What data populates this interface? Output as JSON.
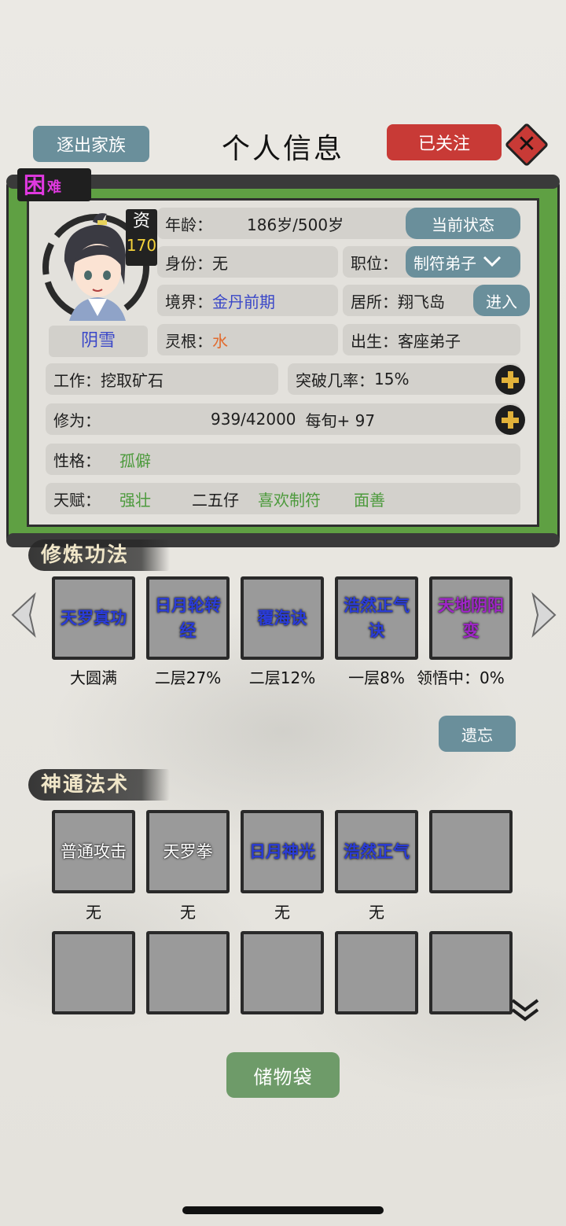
{
  "header": {
    "title": "个人信息",
    "expel_button": "逐出家族",
    "follow_button": "已关注"
  },
  "profile": {
    "status_tag_big": "困",
    "status_tag_small": "难",
    "aptitude_label": "资",
    "aptitude_value": "170",
    "name": "阴雪",
    "age_label": "年龄：",
    "age_value": "186岁/500岁",
    "current_state_button": "当前状态",
    "identity_label": "身份：",
    "identity_value": "无",
    "position_label": "职位：",
    "position_value": "制符弟子",
    "realm_label": "境界：",
    "realm_value": "金丹前期",
    "residence_label": "居所：",
    "residence_value": "翔飞岛",
    "enter_button": "进入",
    "root_label": "灵根：",
    "root_value": "水",
    "birth_label": "出生：",
    "birth_value": "客座弟子",
    "work_label": "工作：",
    "work_value": "挖取矿石",
    "breakthrough_label": "突破几率：",
    "breakthrough_value": "15%",
    "cultivation_label": "修为：",
    "cultivation_value": "939/42000",
    "cultivation_rate": "每旬+ 97",
    "personality_label": "性格：",
    "personality_value": "孤僻",
    "talent_label": "天赋：",
    "talents": [
      "强壮",
      "二五仔",
      "喜欢制符",
      "面善"
    ]
  },
  "techniques": {
    "heading": "修炼功法",
    "items": [
      {
        "name": "天罗真功",
        "progress": "大圆满"
      },
      {
        "name": "日月轮转经",
        "progress": "二层27%"
      },
      {
        "name": "覆海诀",
        "progress": "二层12%"
      },
      {
        "name": "浩然正气诀",
        "progress": "一层8%"
      },
      {
        "name": "天地阴阳变",
        "progress": "领悟中：0%"
      }
    ],
    "forget_button": "遗忘"
  },
  "spells": {
    "heading": "神通法术",
    "items": [
      {
        "name": "普通攻击",
        "level": "无"
      },
      {
        "name": "天罗拳",
        "level": "无"
      },
      {
        "name": "日月神光",
        "level": "无"
      },
      {
        "name": "浩然正气",
        "level": "无"
      }
    ]
  },
  "footer": {
    "bag_button": "储物袋"
  },
  "colors": {
    "scroll_green": "#5fa043",
    "button_blue": "#6a8f9b",
    "button_red": "#c83a36",
    "bag_green": "#6e9b69",
    "text_blue": "#3a47c8",
    "text_purple": "#a026c8",
    "status_magenta": "#e039e0"
  }
}
